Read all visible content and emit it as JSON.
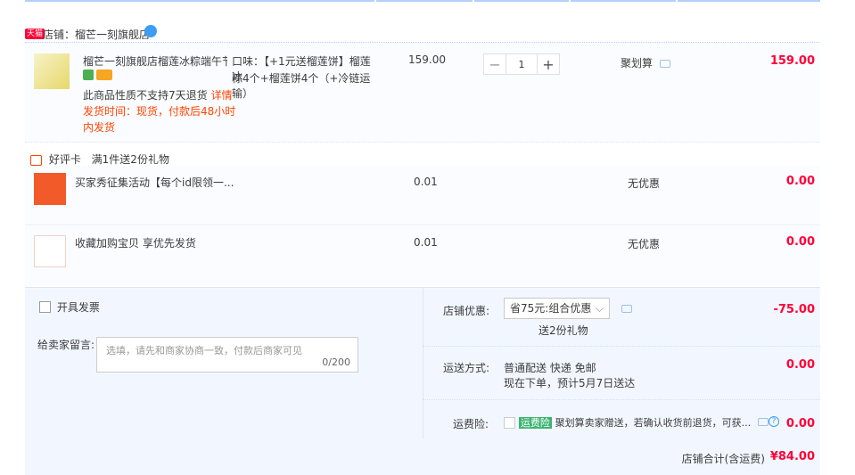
{
  "shop": {
    "badge": "天猫",
    "label": "店铺：榴芒一刻旗舰店"
  },
  "items": [
    {
      "title": "榴芒一刻旗舰店榴莲冰粽端午节...",
      "flavor_line1": "口味：【+1元送榴莲饼】榴莲冰",
      "flavor_line2": "粽4个+榴莲饼4个（+冷链运输）",
      "price": "159.00",
      "quantity": "1",
      "promo": "聚划算",
      "subtotal": "159.00",
      "note1": "此商品性质不支持7天退货",
      "note1_link": "详情",
      "ship_line1": "发货时间：现货，付款后48小时",
      "ship_line2": "内发货"
    }
  ],
  "gift": {
    "label": "好评卡",
    "rule": "满1件送2份礼物",
    "items": [
      {
        "title": "买家秀征集活动【每个id限领一...",
        "price": "0.01",
        "promo": "无优惠",
        "subtotal": "0.00"
      },
      {
        "title": "收藏加购宝贝 享优先发货",
        "price": "0.01",
        "promo": "无优惠",
        "subtotal": "0.00"
      }
    ]
  },
  "invoice": {
    "label": "开具发票"
  },
  "message": {
    "label": "给卖家留言:",
    "placeholder": "选填，请先和商家协商一致，付款后商家可见",
    "counter": "0/200"
  },
  "discount": {
    "label": "店铺优惠:",
    "selected": "省75元:组合优惠",
    "sub": "送2份礼物",
    "amount": "-75.00"
  },
  "shipping": {
    "label": "运送方式:",
    "line1": "普通配送 快递 免邮",
    "line2": "现在下单，预计5月7日送达",
    "amount": "0.00"
  },
  "insurance": {
    "label": "运费险:",
    "tag": "运费险",
    "text": "聚划算卖家赠送，若确认收货前退货，可获...",
    "amount": "0.00"
  },
  "total": {
    "label": "店铺合计(含运费)",
    "amount": "¥84.00"
  },
  "colors": {
    "accent": "#ff0036",
    "orange": "#f40",
    "blue_line": "#b2d1ff"
  }
}
